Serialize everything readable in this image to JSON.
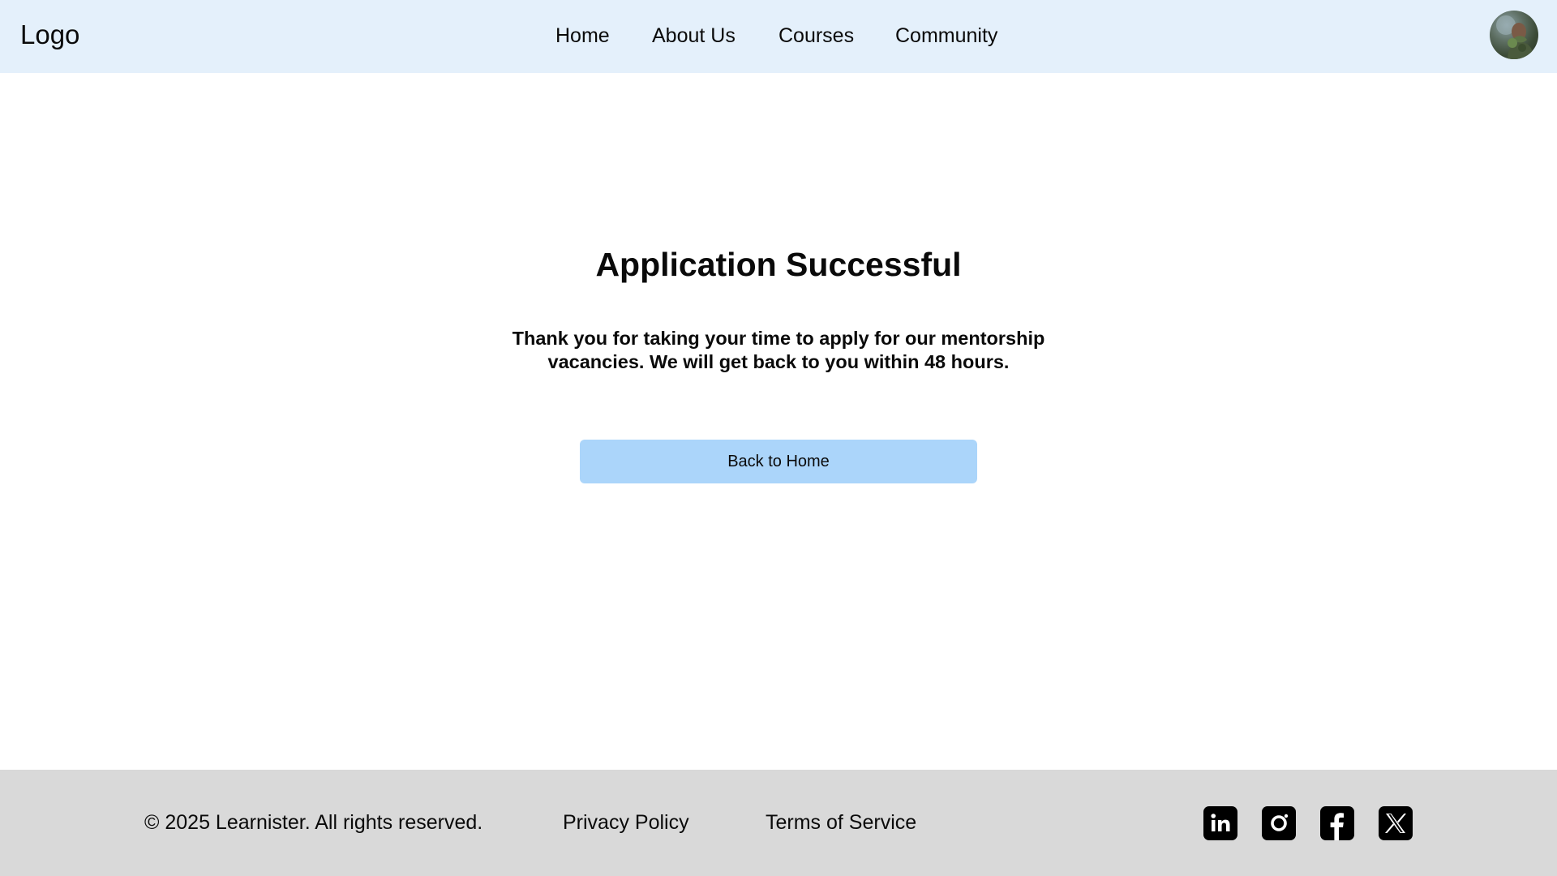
{
  "header": {
    "logo": "Logo",
    "nav": [
      "Home",
      "About Us",
      "Courses",
      "Community"
    ],
    "avatar_icon": "user-avatar"
  },
  "main": {
    "title": "Application Successful",
    "message": "Thank you for taking your time to apply for our mentorship vacancies. We will get back to you within 48 hours.",
    "button_label": "Back to Home"
  },
  "footer": {
    "copyright": "© 2025 Learnister. All rights reserved.",
    "privacy": "Privacy Policy",
    "terms": "Terms of Service",
    "social_icons": [
      "linkedin-icon",
      "instagram-icon",
      "facebook-icon",
      "x-icon"
    ]
  },
  "colors": {
    "header_bg": "#e4f0fb",
    "button_bg": "#abd5fa",
    "footer_bg": "#d9d9d9",
    "text": "#0a0a0a"
  }
}
